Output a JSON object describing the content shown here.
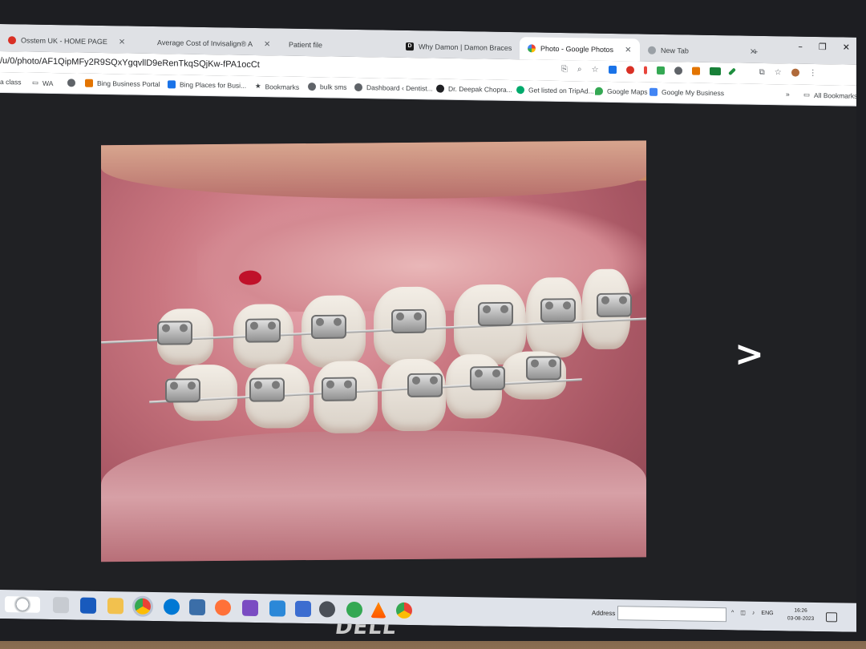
{
  "tabs": [
    {
      "title": "Osstem UK - HOME PAGE",
      "icon": "osstem-icon"
    },
    {
      "title": "Average Cost of Invisalign® A",
      "icon": "none"
    },
    {
      "title": "Patient file",
      "icon": "none"
    },
    {
      "title": "Why Damon | Damon Braces",
      "icon": "document-icon"
    },
    {
      "title": "Photo - Google Photos",
      "icon": "google-photos-icon"
    },
    {
      "title": "New Tab",
      "icon": "chrome-icon"
    }
  ],
  "address": {
    "url": "/u/0/photo/AF1QipMFy2R9SQxYgqvllD9eRenTkqSQjKw-fPA1ocCt"
  },
  "bookmarks": [
    {
      "label": "a class"
    },
    {
      "label": "WA"
    },
    {
      "label": ""
    },
    {
      "label": "Bing Business Portal"
    },
    {
      "label": "Bing Places for Busi..."
    },
    {
      "label": "Bookmarks"
    },
    {
      "label": "bulk sms"
    },
    {
      "label": "Dashboard ‹ Dentist..."
    },
    {
      "label": "Dr. Deepak Chopra..."
    },
    {
      "label": "Get listed on TripAd..."
    },
    {
      "label": "Google Maps"
    },
    {
      "label": "Google My Business"
    }
  ],
  "bookmarks_right": "All Bookmarks",
  "taskbar": {
    "address_label": "Address",
    "language": "ENG",
    "time": "16:26",
    "date": "03-08-2023"
  },
  "monitor_brand": "DELL",
  "colors": {
    "tabbar": "#dfe1e5",
    "viewer_bg": "#202124",
    "taskbar": "#dfe3ea"
  }
}
